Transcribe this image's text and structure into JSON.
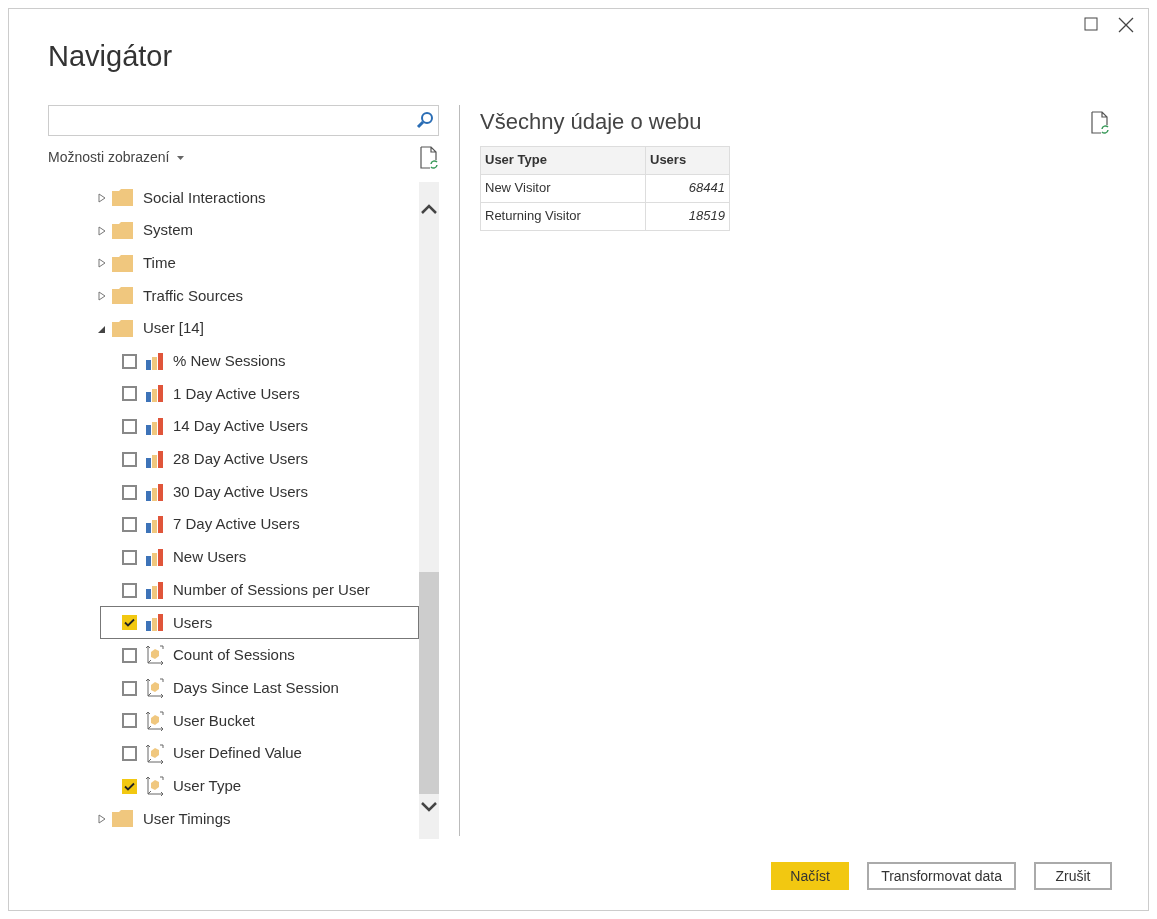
{
  "window": {
    "title": "Navigátor"
  },
  "display_options": {
    "label": "Možnosti zobrazení"
  },
  "tree": [
    {
      "label": "Social Interactions",
      "expanded": false
    },
    {
      "label": "System",
      "expanded": false
    },
    {
      "label": "Time",
      "expanded": false
    },
    {
      "label": "Traffic Sources",
      "expanded": false
    },
    {
      "label": "User [14]",
      "expanded": true,
      "children": [
        {
          "label": "% New Sessions",
          "kind": "measure",
          "checked": false,
          "selected": false
        },
        {
          "label": "1 Day Active Users",
          "kind": "measure",
          "checked": false,
          "selected": false
        },
        {
          "label": "14 Day Active Users",
          "kind": "measure",
          "checked": false,
          "selected": false
        },
        {
          "label": "28 Day Active Users",
          "kind": "measure",
          "checked": false,
          "selected": false
        },
        {
          "label": "30 Day Active Users",
          "kind": "measure",
          "checked": false,
          "selected": false
        },
        {
          "label": "7 Day Active Users",
          "kind": "measure",
          "checked": false,
          "selected": false
        },
        {
          "label": "New Users",
          "kind": "measure",
          "checked": false,
          "selected": false
        },
        {
          "label": "Number of Sessions per User",
          "kind": "measure",
          "checked": false,
          "selected": false
        },
        {
          "label": "Users",
          "kind": "measure",
          "checked": true,
          "selected": true
        },
        {
          "label": "Count of Sessions",
          "kind": "dimension",
          "checked": false,
          "selected": false
        },
        {
          "label": "Days Since Last Session",
          "kind": "dimension",
          "checked": false,
          "selected": false
        },
        {
          "label": "User Bucket",
          "kind": "dimension",
          "checked": false,
          "selected": false
        },
        {
          "label": "User Defined Value",
          "kind": "dimension",
          "checked": false,
          "selected": false
        },
        {
          "label": "User Type",
          "kind": "dimension",
          "checked": true,
          "selected": false
        }
      ]
    },
    {
      "label": "User Timings",
      "expanded": false
    }
  ],
  "preview": {
    "title": "Všechny údaje o webu",
    "table": {
      "columns": [
        "User Type",
        "Users"
      ],
      "rows": [
        [
          "New Visitor",
          "68441"
        ],
        [
          "Returning Visitor",
          "18519"
        ]
      ]
    }
  },
  "buttons": [
    {
      "label": "Načíst",
      "kind": "primary"
    },
    {
      "label": "Transformovat data",
      "kind": "secondary"
    },
    {
      "label": "Zrušit",
      "kind": "secondary"
    }
  ]
}
